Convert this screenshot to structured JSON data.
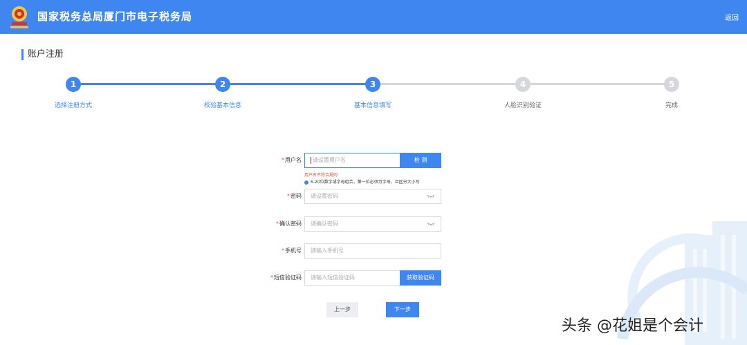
{
  "header": {
    "site_title": "国家税务总局厦门市电子税务局",
    "back_label": "返回"
  },
  "page": {
    "title": "账户注册"
  },
  "steps": [
    {
      "number": "1",
      "label": "选择注册方式",
      "state": "done"
    },
    {
      "number": "2",
      "label": "校验基本信息",
      "state": "done"
    },
    {
      "number": "3",
      "label": "基本信息填写",
      "state": "current"
    },
    {
      "number": "4",
      "label": "人脸识别验证",
      "state": "pending"
    },
    {
      "number": "5",
      "label": "完成",
      "state": "pending"
    }
  ],
  "form": {
    "required_mark": "*",
    "username": {
      "label": "用户名",
      "placeholder": "请设置用户名",
      "check_button": "检 测",
      "error": "用户名不符合规则",
      "hint": "6-20位数字或字母组合，第一位必须为字母，且区分大小写"
    },
    "password": {
      "label": "密码",
      "placeholder": "请设置密码"
    },
    "confirm_password": {
      "label": "确认密码",
      "placeholder": "请确认密码"
    },
    "phone": {
      "label": "手机号",
      "placeholder": "请输入手机号"
    },
    "sms_code": {
      "label": "短信验证码",
      "placeholder": "请输入短信验证码",
      "get_code_button": "获取验证码"
    }
  },
  "actions": {
    "prev": "上一步",
    "next": "下一步"
  },
  "watermark": "头条 @花姐是个会计",
  "colors": {
    "accent": "#3f86f0",
    "error": "#e84c3d",
    "inactive": "#d5d7da"
  }
}
